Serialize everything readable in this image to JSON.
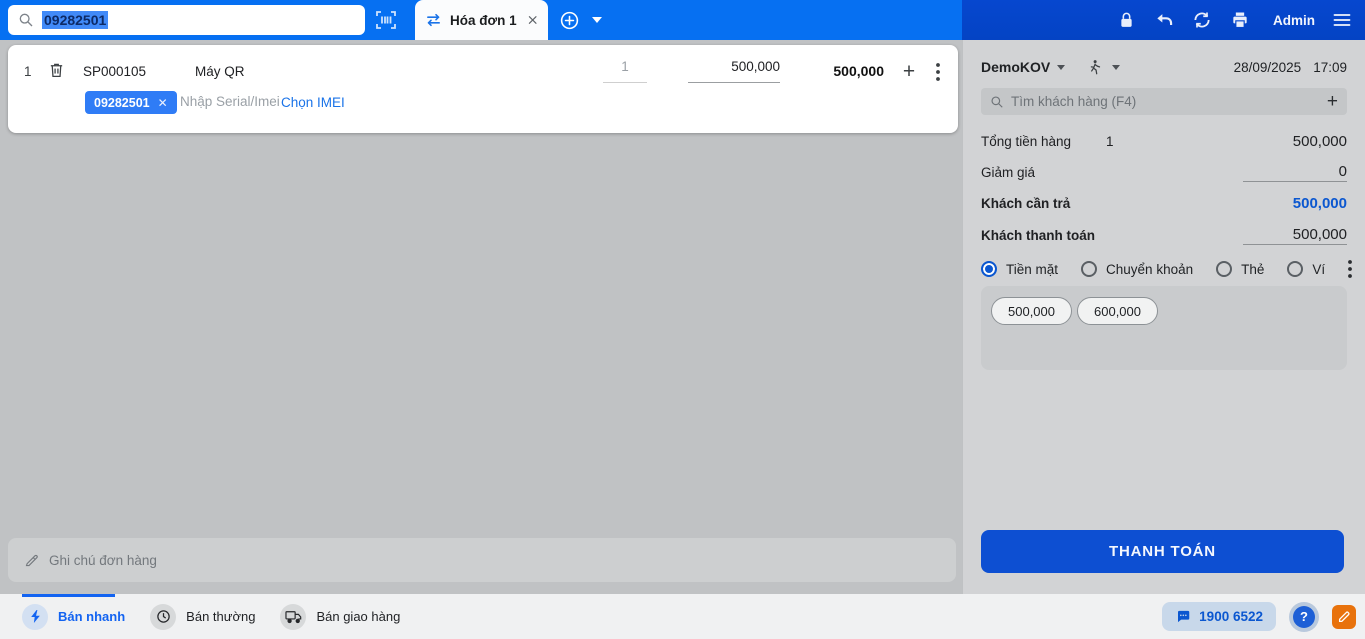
{
  "colors": {
    "topbar_left": "#0670f2",
    "topbar_right": "#0545cb",
    "accent_link": "#1a73e8",
    "deep_blue": "#0b57d0",
    "pay_button": "#0d4fd2",
    "main_bg": "#c0c2c4",
    "panel_bg": "#d2d3d5",
    "serial_tag_bg": "#2f7cf6",
    "selection_bg": "#418af8",
    "feedback_orange": "#e8720c"
  },
  "topbar": {
    "search_value": "09282501",
    "tab_label": "Hóa đơn 1",
    "admin_label": "Admin"
  },
  "cart": {
    "index": "1",
    "code": "SP000105",
    "name": "Máy QR",
    "qty": "1",
    "unit_price": "500,000",
    "line_total": "500,000",
    "serial_tag": "09282501",
    "serial_placeholder": "Nhập Serial/Imei",
    "choose_imei_label": "Chọn IMEI",
    "note_placeholder": "Ghi chú đơn hàng"
  },
  "panel": {
    "branch": "DemoKOV",
    "date": "28/09/2025",
    "time": "17:09",
    "customer_search_placeholder": "Tìm khách hàng (F4)",
    "subtotal_label": "Tổng tiền hàng",
    "subtotal_count": "1",
    "subtotal_value": "500,000",
    "discount_label": "Giảm giá",
    "discount_value": "0",
    "due_label": "Khách cần trả",
    "due_value": "500,000",
    "paid_label": "Khách thanh toán",
    "paid_value": "500,000",
    "payment_methods": [
      {
        "label": "Tiền mặt",
        "selected": true
      },
      {
        "label": "Chuyển khoản",
        "selected": false
      },
      {
        "label": "Thẻ",
        "selected": false
      },
      {
        "label": "Ví",
        "selected": false
      }
    ],
    "cash_suggestions": [
      "500,000",
      "600,000"
    ],
    "pay_button_label": "THANH TOÁN"
  },
  "bottombar": {
    "modes": [
      {
        "label": "Bán nhanh",
        "active": true
      },
      {
        "label": "Bán thường",
        "active": false
      },
      {
        "label": "Bán giao hàng",
        "active": false
      }
    ],
    "hotline": "1900 6522"
  }
}
